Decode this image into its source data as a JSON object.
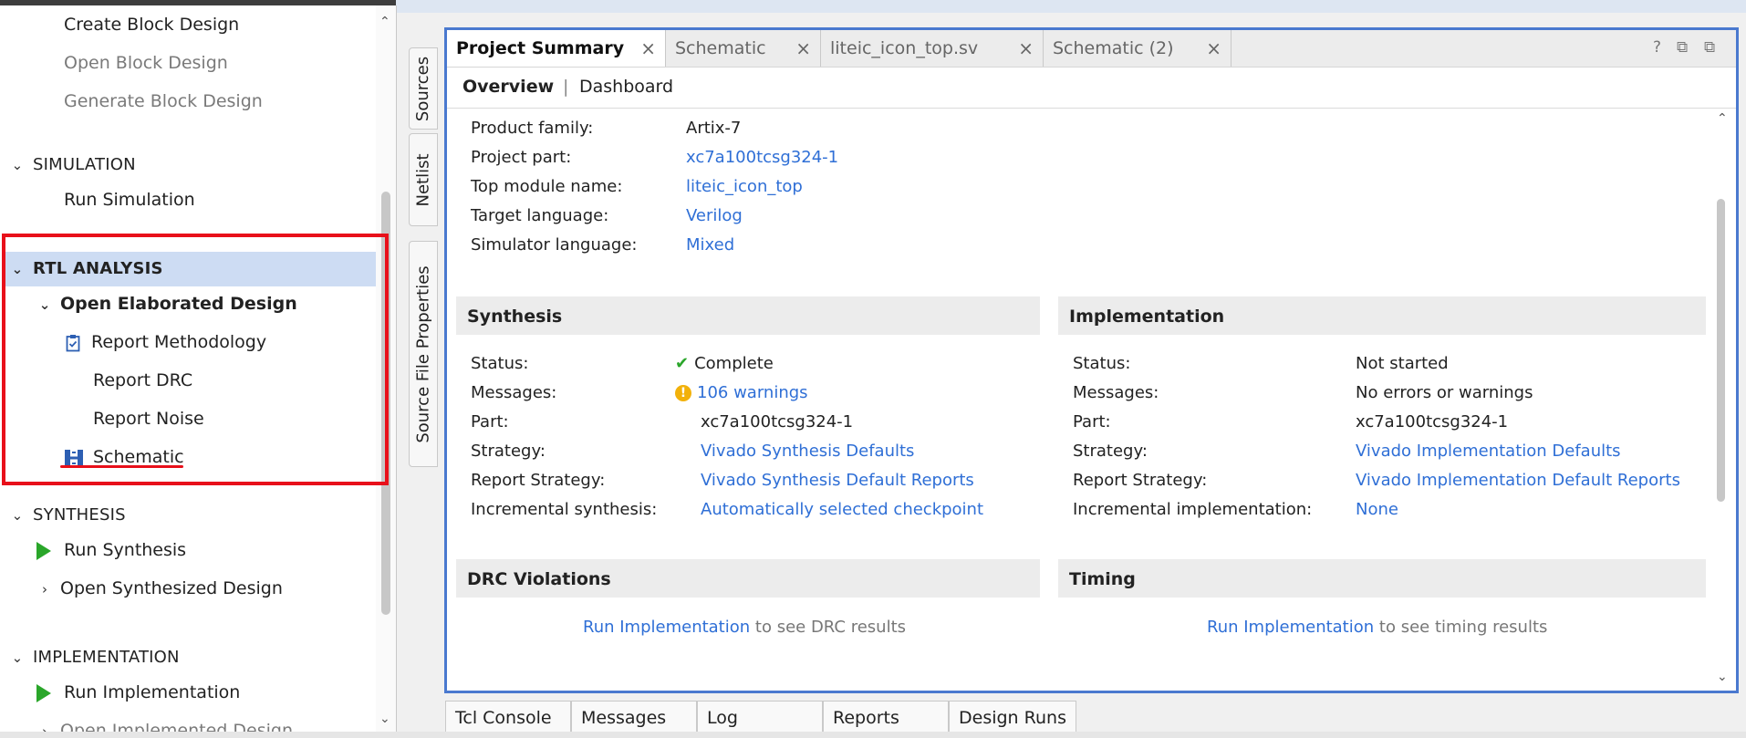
{
  "navigator": {
    "items": {
      "create_block_design": "Create Block Design",
      "open_block_design": "Open Block Design",
      "generate_block_design": "Generate Block Design",
      "simulation": "SIMULATION",
      "run_simulation": "Run Simulation",
      "rtl_analysis": "RTL ANALYSIS",
      "open_elaborated_design": "Open Elaborated Design",
      "report_methodology": "Report Methodology",
      "report_drc": "Report DRC",
      "report_noise": "Report Noise",
      "schematic": "Schematic",
      "synthesis": "SYNTHESIS",
      "run_synthesis": "Run Synthesis",
      "open_synthesized_design": "Open Synthesized Design",
      "implementation": "IMPLEMENTATION",
      "run_implementation": "Run Implementation",
      "open_implemented_design": "Open Implemented Design"
    },
    "highlight_color": "#e8101a"
  },
  "side_tabs": [
    "Sources",
    "Netlist",
    "Source File Properties"
  ],
  "editor_tabs": [
    "Project Summary",
    "Schematic",
    "liteic_icon_top.sv",
    "Schematic (2)"
  ],
  "toolbar_icons": [
    "help-icon",
    "restore-icon",
    "maximize-icon"
  ],
  "subtabs": {
    "overview": "Overview",
    "dashboard": "Dashboard"
  },
  "project": {
    "rows": [
      {
        "label": "Product family:",
        "value": "Artix-7",
        "link": false
      },
      {
        "label": "Project part:",
        "value": "xc7a100tcsg324-1",
        "link": true
      },
      {
        "label": "Top module name:",
        "value": "liteic_icon_top",
        "link": true
      },
      {
        "label": "Target language:",
        "value": "Verilog",
        "link": true
      },
      {
        "label": "Simulator language:",
        "value": "Mixed",
        "link": true
      }
    ]
  },
  "synthesis": {
    "title": "Synthesis",
    "rows": [
      {
        "label": "Status:",
        "value": "Complete"
      },
      {
        "label": "Messages:",
        "value": "106 warnings"
      },
      {
        "label": "Part:",
        "value": "xc7a100tcsg324-1"
      },
      {
        "label": "Strategy:",
        "value": "Vivado Synthesis Defaults"
      },
      {
        "label": "Report Strategy:",
        "value": "Vivado Synthesis Default Reports"
      },
      {
        "label": "Incremental synthesis:",
        "value": "Automatically selected checkpoint"
      }
    ]
  },
  "implementation": {
    "title": "Implementation",
    "rows": [
      {
        "label": "Status:",
        "value": "Not started"
      },
      {
        "label": "Messages:",
        "value": "No errors or warnings"
      },
      {
        "label": "Part:",
        "value": "xc7a100tcsg324-1"
      },
      {
        "label": "Strategy:",
        "value": "Vivado Implementation Defaults"
      },
      {
        "label": "Report Strategy:",
        "value": "Vivado Implementation Default Reports"
      },
      {
        "label": "Incremental implementation:",
        "value": "None"
      }
    ]
  },
  "drc": {
    "title": "DRC Violations",
    "link": "Run Implementation",
    "text": "to see DRC results"
  },
  "timing": {
    "title": "Timing",
    "link": "Run Implementation",
    "text": "to see timing results"
  },
  "bottom_tabs": [
    "Tcl Console",
    "Messages",
    "Log",
    "Reports",
    "Design Runs"
  ],
  "colors": {
    "link": "#2f6fd6",
    "panel_border": "#4a79cf",
    "success": "#2aa62a",
    "warning": "#f2b10a"
  }
}
